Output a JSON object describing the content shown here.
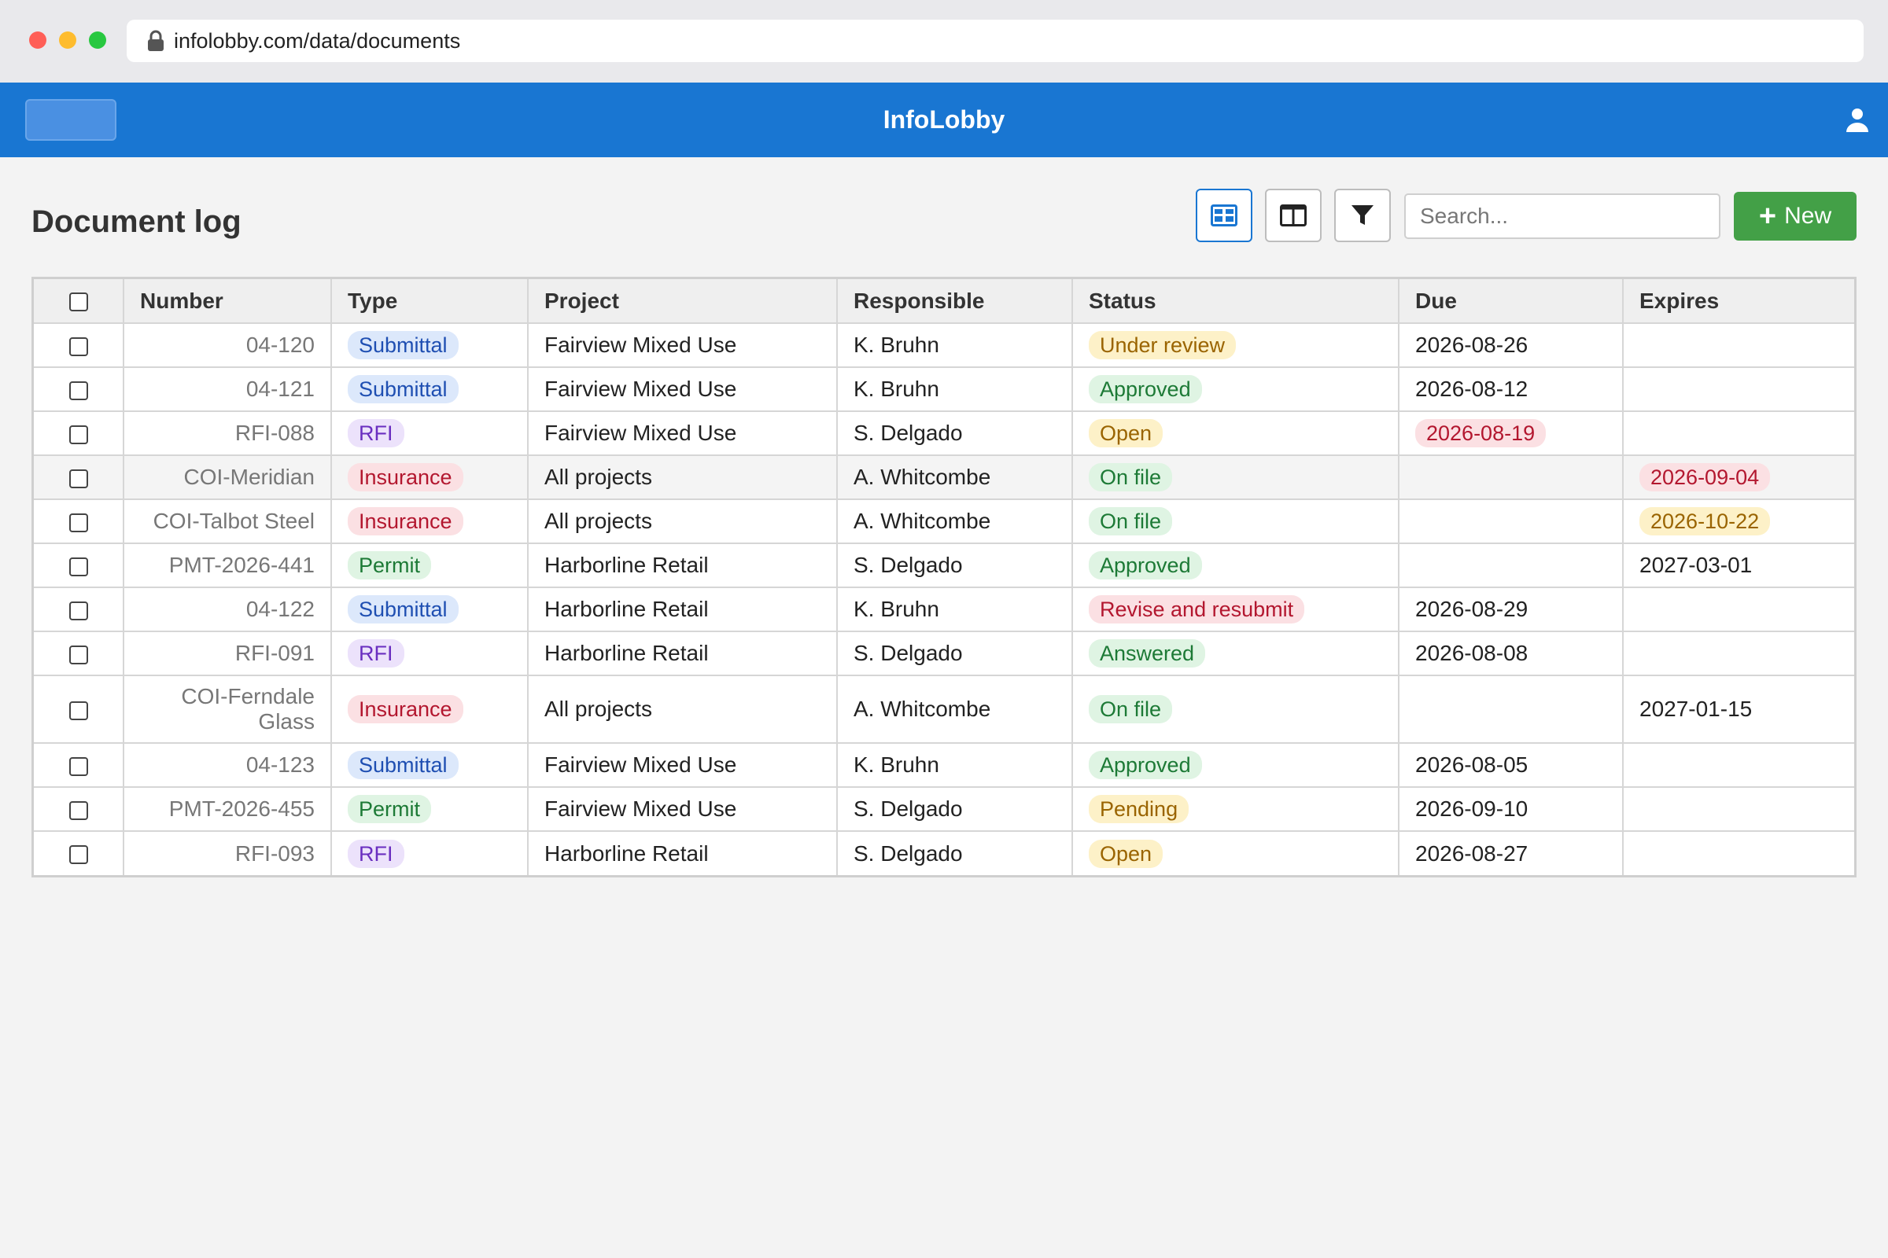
{
  "browser": {
    "url": "infolobby.com/data/documents"
  },
  "app": {
    "title": "InfoLobby"
  },
  "page": {
    "title": "Document log"
  },
  "toolbar": {
    "search_placeholder": "Search...",
    "new_label": "New"
  },
  "table": {
    "columns": [
      "Number",
      "Type",
      "Project",
      "Responsible",
      "Status",
      "Due",
      "Expires"
    ],
    "rows": [
      {
        "number": "04-120",
        "type": "Submittal",
        "project": "Fairview Mixed Use",
        "responsible": "K. Bruhn",
        "status": "Under review",
        "due": "2026-08-26",
        "expires": ""
      },
      {
        "number": "04-121",
        "type": "Submittal",
        "project": "Fairview Mixed Use",
        "responsible": "K. Bruhn",
        "status": "Approved",
        "due": "2026-08-12",
        "expires": ""
      },
      {
        "number": "RFI-088",
        "type": "RFI",
        "project": "Fairview Mixed Use",
        "responsible": "S. Delgado",
        "status": "Open",
        "due": "2026-08-19",
        "expires": ""
      },
      {
        "number": "COI-Meridian",
        "type": "Insurance",
        "project": "All projects",
        "responsible": "A. Whitcombe",
        "status": "On file",
        "due": "",
        "expires": "2026-09-04"
      },
      {
        "number": "COI-Talbot Steel",
        "type": "Insurance",
        "project": "All projects",
        "responsible": "A. Whitcombe",
        "status": "On file",
        "due": "",
        "expires": "2026-10-22"
      },
      {
        "number": "PMT-2026-441",
        "type": "Permit",
        "project": "Harborline Retail",
        "responsible": "S. Delgado",
        "status": "Approved",
        "due": "",
        "expires": "2027-03-01"
      },
      {
        "number": "04-122",
        "type": "Submittal",
        "project": "Harborline Retail",
        "responsible": "K. Bruhn",
        "status": "Revise and resubmit",
        "due": "2026-08-29",
        "expires": ""
      },
      {
        "number": "RFI-091",
        "type": "RFI",
        "project": "Harborline Retail",
        "responsible": "S. Delgado",
        "status": "Answered",
        "due": "2026-08-08",
        "expires": ""
      },
      {
        "number": "COI-Ferndale Glass",
        "type": "Insurance",
        "project": "All projects",
        "responsible": "A. Whitcombe",
        "status": "On file",
        "due": "",
        "expires": "2027-01-15"
      },
      {
        "number": "04-123",
        "type": "Submittal",
        "project": "Fairview Mixed Use",
        "responsible": "K. Bruhn",
        "status": "Approved",
        "due": "2026-08-05",
        "expires": ""
      },
      {
        "number": "PMT-2026-455",
        "type": "Permit",
        "project": "Fairview Mixed Use",
        "responsible": "S. Delgado",
        "status": "Pending",
        "due": "2026-09-10",
        "expires": ""
      },
      {
        "number": "RFI-093",
        "type": "RFI",
        "project": "Harborline Retail",
        "responsible": "S. Delgado",
        "status": "Open",
        "due": "2026-08-27",
        "expires": ""
      }
    ]
  }
}
